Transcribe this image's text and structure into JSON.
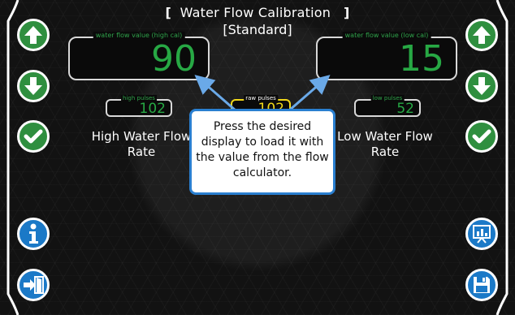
{
  "title": {
    "line1": "Water Flow Calibration",
    "line2": "[Standard]",
    "bracket_open": "[",
    "bracket_close": "]"
  },
  "displays": {
    "high_cal": {
      "caption": "water flow value (high cal)",
      "value": "90"
    },
    "low_cal": {
      "caption": "water flow value (low cal)",
      "value": "15"
    },
    "high_pulses": {
      "caption": "high pulses",
      "value": "102"
    },
    "raw_pulses": {
      "caption": "raw pulses",
      "value": "102"
    },
    "low_pulses": {
      "caption": "low pulses",
      "value": "52"
    }
  },
  "labels": {
    "high_rate": "High Water Flow Rate",
    "low_rate": "Low Water Flow Rate"
  },
  "tooltip": {
    "text": "Press the desired display to load it with the value from the flow calculator."
  },
  "buttons": {
    "left": [
      "up-arrow-icon",
      "down-arrow-icon",
      "checkmark-icon",
      "info-icon",
      "exit-door-icon"
    ],
    "right": [
      "up-arrow-icon",
      "down-arrow-icon",
      "checkmark-icon",
      "chart-board-icon",
      "floppy-disk-icon"
    ]
  },
  "colors": {
    "accent_green": "#2f8f3f",
    "value_green": "#27a844",
    "accent_blue": "#1b79c7",
    "raw_yellow": "#f1d81a",
    "tooltip_border": "#2a7fd0"
  }
}
